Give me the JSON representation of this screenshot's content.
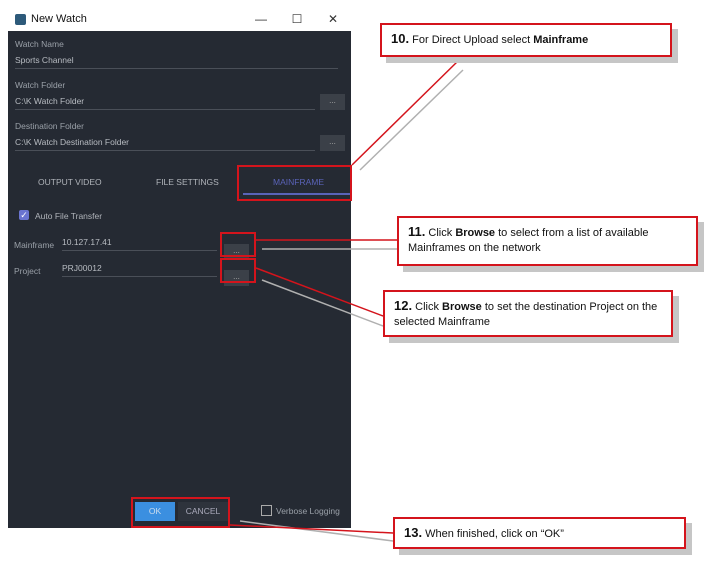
{
  "window": {
    "title": "New Watch",
    "minimize": "—",
    "maximize": "☐",
    "close": "✕"
  },
  "fields": {
    "watch_name": {
      "label": "Watch Name",
      "value": "Sports Channel"
    },
    "watch_folder": {
      "label": "Watch Folder",
      "value": "C:\\K Watch Folder",
      "browse": "..."
    },
    "destination_folder": {
      "label": "Destination Folder",
      "value": "C:\\K Watch Destination Folder",
      "browse": "..."
    }
  },
  "tabs": [
    {
      "label": "OUTPUT VIDEO"
    },
    {
      "label": "FILE SETTINGS"
    },
    {
      "label": "MAINFRAME",
      "active": true
    }
  ],
  "mainframe": {
    "auto_transfer": {
      "label": "Auto File Transfer",
      "checked": true
    },
    "mainframe": {
      "label": "Mainframe",
      "value": "10.127.17.41",
      "browse": "..."
    },
    "project": {
      "label": "Project",
      "value": "PRJ00012",
      "browse": "..."
    }
  },
  "footer": {
    "ok": "OK",
    "cancel": "CANCEL",
    "verbose": "Verbose Logging",
    "verbose_checked": false
  },
  "callouts": [
    {
      "num": "10.",
      "pre": "For Direct Upload select ",
      "bold": "Mainframe",
      "post": ""
    },
    {
      "num": "11.",
      "pre": "Click ",
      "bold": "Browse",
      "post": " to select from a list of available Mainframes on the network"
    },
    {
      "num": "12.",
      "pre": "Click ",
      "bold": "Browse",
      "post": " to set the destination Project on the selected Mainframe"
    },
    {
      "num": "13.",
      "pre": "When finished, click on “OK”",
      "bold": "",
      "post": ""
    }
  ],
  "colors": {
    "accent": "#3b8fe0",
    "highlight": "#d4141c",
    "tab_active": "#5a63b8"
  }
}
